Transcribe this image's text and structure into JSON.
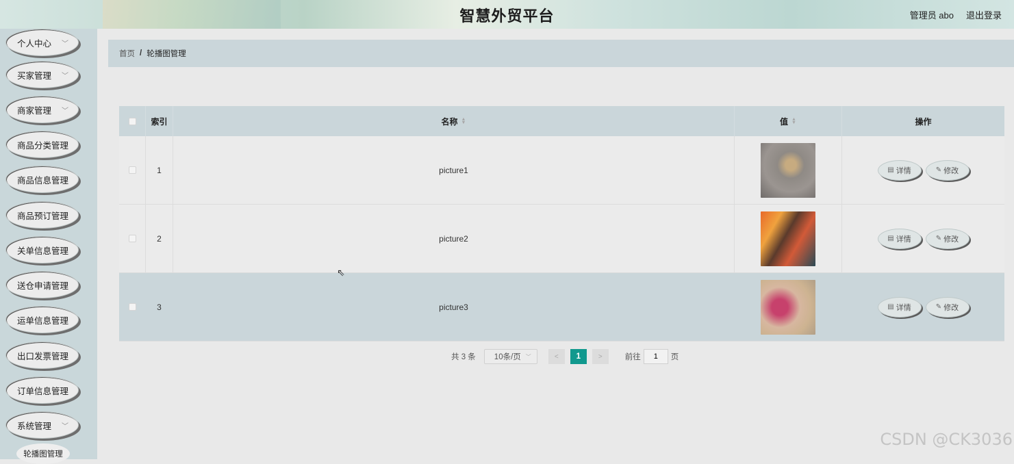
{
  "header": {
    "title": "智慧外贸平台",
    "user": "管理员 abo",
    "logout": "退出登录"
  },
  "sidebar": {
    "items": [
      {
        "label": "个人中心",
        "chevron": true
      },
      {
        "label": "买家管理",
        "chevron": true
      },
      {
        "label": "商家管理",
        "chevron": true
      },
      {
        "label": "商品分类管理",
        "chevron": false
      },
      {
        "label": "商品信息管理",
        "chevron": false
      },
      {
        "label": "商品预订管理",
        "chevron": false
      },
      {
        "label": "关单信息管理",
        "chevron": false
      },
      {
        "label": "送仓申请管理",
        "chevron": false
      },
      {
        "label": "运单信息管理",
        "chevron": false
      },
      {
        "label": "出口发票管理",
        "chevron": false
      },
      {
        "label": "订单信息管理",
        "chevron": false
      },
      {
        "label": "系统管理",
        "chevron": true
      }
    ],
    "submenu": {
      "label": "轮播图管理"
    }
  },
  "breadcrumb": {
    "home": "首页",
    "separator": "/",
    "current": "轮播图管理"
  },
  "table": {
    "headers": {
      "index": "索引",
      "name": "名称",
      "value": "值",
      "operation": "操作"
    },
    "rows": [
      {
        "index": "1",
        "name": "picture1",
        "image": "thumbnail-1"
      },
      {
        "index": "2",
        "name": "picture2",
        "image": "thumbnail-2"
      },
      {
        "index": "3",
        "name": "picture3",
        "image": "thumbnail-3"
      }
    ],
    "actions": {
      "detail": "详情",
      "edit": "修改"
    }
  },
  "pagination": {
    "total": "共 3 条",
    "page_size": "10条/页",
    "current_page": "1",
    "goto_label": "前往",
    "goto_value": "1",
    "page_suffix": "页"
  },
  "watermark": "CSDN @CK3036",
  "colors": {
    "accent": "#11998e",
    "sidebar_bg": "#c9d7da",
    "header_row": "#cad6da"
  }
}
